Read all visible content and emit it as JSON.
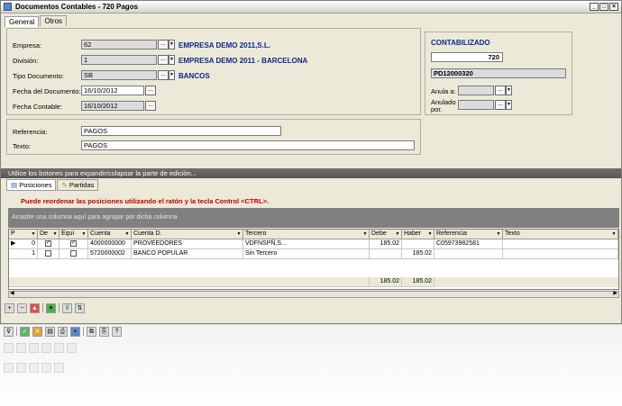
{
  "window": {
    "title": "Documentos Contables - 720  Pagos",
    "controls": [
      "_",
      "□",
      "×"
    ]
  },
  "tabs": [
    {
      "label": "General",
      "active": true
    },
    {
      "label": "Otros",
      "active": false
    }
  ],
  "header_form": {
    "empresa": {
      "label": "Empresa:",
      "value": "62",
      "desc": "EMPRESA DEMO 2011,S.L."
    },
    "division": {
      "label": "División:",
      "value": "1",
      "desc": "EMPRESA DEMO 2011 - BARCELONA"
    },
    "tipo": {
      "label": "Tipo Documento:",
      "value": "SB",
      "desc": "BANCOS"
    },
    "fecha_doc": {
      "label": "Fecha del Documento:",
      "value": "16/10/2012"
    },
    "fecha_cont": {
      "label": "Fecha Contable:",
      "value": "16/10/2012"
    }
  },
  "status_panel": {
    "status": "CONTABILIZADO",
    "number": "720",
    "code": "PD12000320",
    "anula_label": "Anula a:",
    "anulado_label": "Anulado\npor."
  },
  "ref_form": {
    "referencia": {
      "label": "Referencia:",
      "value": "PAGOS"
    },
    "texto": {
      "label": "Texto:",
      "value": "PAGOS"
    }
  },
  "hint_bar": "Utilice los botones para expandir/colapsar la parte de edición...",
  "subtabs": [
    {
      "label": "Posiciones",
      "icon": "list-icon"
    },
    {
      "label": "Partidas",
      "icon": "edit-icon"
    }
  ],
  "reorder_msg": "Puede reordenar las posiciones utilizando el ratón y la tecla Control <CTRL>.",
  "group_hint": "Arrastre una columna aquí para agrupar por dicha columna",
  "grid": {
    "columns": [
      "P",
      "De",
      "Equi",
      "Cuenta",
      "Cuenta D.",
      "Tercero",
      "Debe",
      "Haber",
      "Referencia",
      "Texto"
    ],
    "rows": [
      {
        "p": "0",
        "de": true,
        "equi": true,
        "cuenta": "4000000000",
        "cuenta_d": "PROVEEDORES",
        "tercero": "VDFNSPÑ,S...",
        "debe": "185.02",
        "haber": "",
        "referencia": "C05973982581",
        "texto": ""
      },
      {
        "p": "1",
        "de": false,
        "equi": false,
        "cuenta": "5720000002",
        "cuenta_d": "BANCO POPULAR",
        "tercero": "Sin Tercero",
        "debe": "",
        "haber": "185.02",
        "referencia": "",
        "texto": ""
      }
    ],
    "totals": {
      "debe": "185.02",
      "haber": "185.02"
    }
  }
}
